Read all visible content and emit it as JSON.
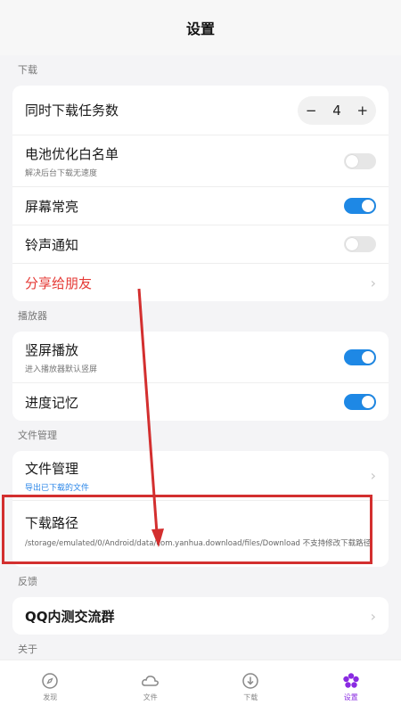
{
  "header": {
    "title": "设置"
  },
  "sections": {
    "download": {
      "label": "下载",
      "concurrent": {
        "title": "同时下载任务数",
        "minus": "−",
        "value": "4",
        "plus": "+"
      },
      "battery": {
        "title": "电池优化白名单",
        "subtitle": "解决后台下载无速度",
        "enabled": false
      },
      "screen": {
        "title": "屏幕常亮",
        "enabled": true
      },
      "ringtone": {
        "title": "铃声通知",
        "enabled": false
      },
      "share": {
        "title": "分享给朋友"
      }
    },
    "player": {
      "label": "播放器",
      "portrait": {
        "title": "竖屏播放",
        "subtitle": "进入播放器默认竖屏",
        "enabled": true
      },
      "progress": {
        "title": "进度记忆",
        "enabled": true
      }
    },
    "files": {
      "label": "文件管理",
      "manage": {
        "title": "文件管理",
        "subtitle": "导出已下载的文件"
      },
      "path": {
        "title": "下载路径",
        "value": "/storage/emulated/0/Android/data/com.yanhua.download/files/Download  不支持修改下载路径"
      }
    },
    "feedback": {
      "label": "反馈",
      "qq": {
        "title": "QQ内测交流群"
      }
    },
    "about": {
      "label": "关于"
    }
  },
  "tabs": [
    {
      "label": "发现"
    },
    {
      "label": "文件"
    },
    {
      "label": "下载"
    },
    {
      "label": "设置"
    }
  ],
  "colors": {
    "accent": "#1e88e5",
    "danger": "#e53935",
    "active_tab": "#8a2be2",
    "annotation": "#d32f2f"
  }
}
